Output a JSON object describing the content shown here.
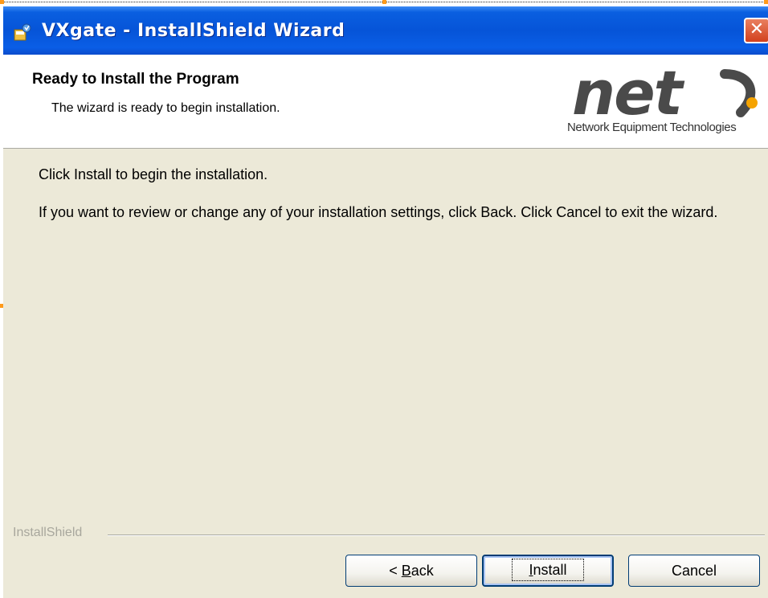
{
  "window": {
    "title": "VXgate - InstallShield Wizard",
    "close_glyph": "✕"
  },
  "header": {
    "title": "Ready to Install the Program",
    "subtitle": "The wizard is ready to begin installation.",
    "logo": {
      "wordmark": "net",
      "tagline": "Network Equipment Technologies",
      "accent_color": "#f5a300",
      "wordmark_color": "#4a4a4a"
    }
  },
  "body": {
    "line1": "Click Install to begin the installation.",
    "line2": "If you want to review or change any of your installation settings, click Back. Click Cancel to exit the wizard."
  },
  "footer": {
    "brand": "InstallShield",
    "buttons": {
      "back": {
        "prefix": "< ",
        "mnemonic": "B",
        "rest": "ack"
      },
      "install": {
        "mnemonic": "I",
        "rest": "nstall"
      },
      "cancel": {
        "label": "Cancel"
      }
    }
  },
  "icons": {
    "app": "installer-icon",
    "close": "close-icon"
  }
}
